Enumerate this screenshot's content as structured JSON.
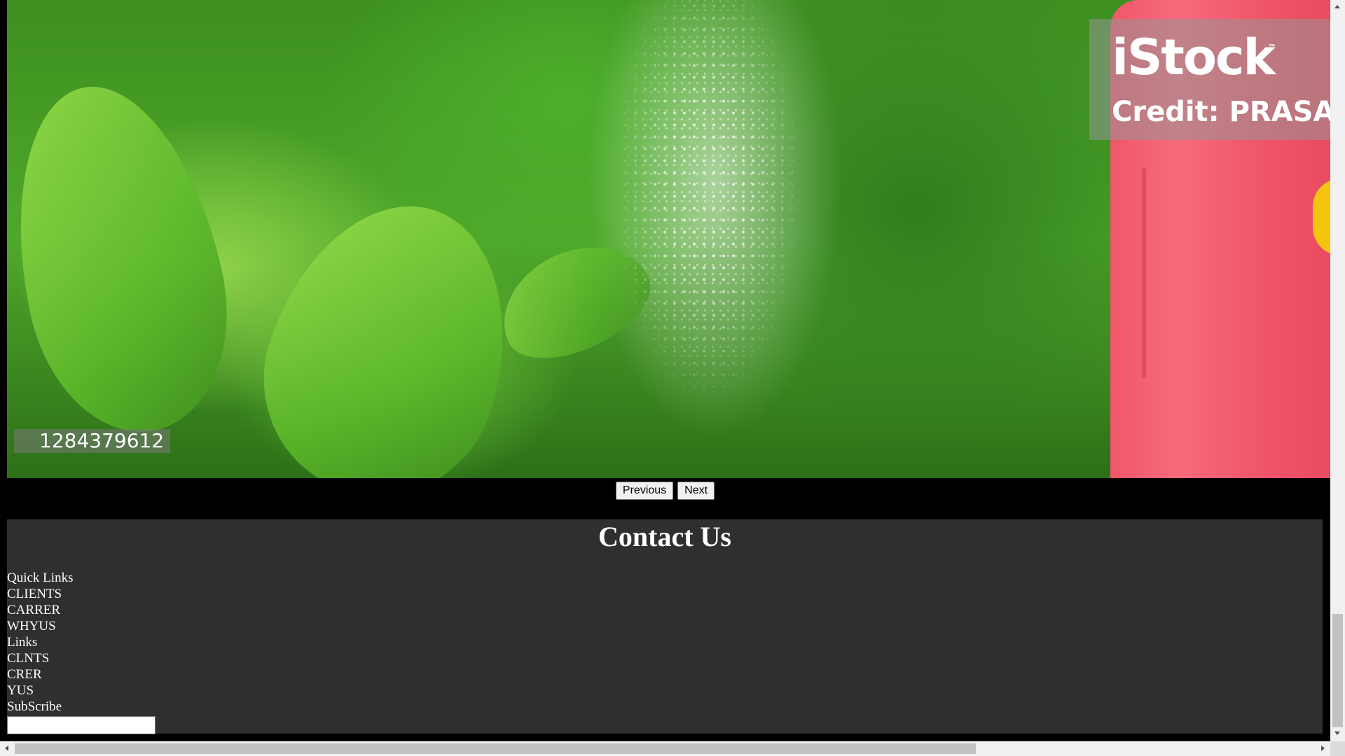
{
  "slideshow": {
    "watermark_brand": "iStock",
    "watermark_tm": "™",
    "watermark_credit": "Credit: PRASAN",
    "image_id": "1284379612",
    "previous_label": "Previous",
    "next_label": "Next"
  },
  "contact": {
    "heading": "Contact Us",
    "quick_links_title": "Quick Links",
    "quick_links": [
      "CLIENTS",
      "CARRER",
      "WHYUS"
    ],
    "links_title": "Links",
    "links": [
      "CLNTS",
      "CRER",
      "YUS"
    ],
    "subscribe_label": "SubScribe",
    "subscribe_value": ""
  },
  "colors": {
    "page_background": "#000000",
    "contact_background": "#2f2f2f",
    "contact_text": "#ffffff"
  }
}
